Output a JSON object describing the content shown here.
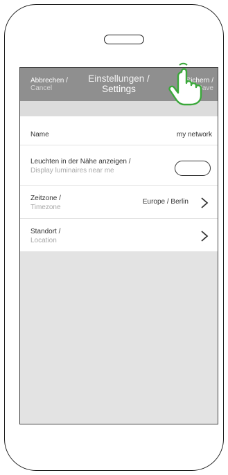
{
  "navbar": {
    "cancel_de": "Abbrechen /",
    "cancel_en": "Cancel",
    "title_de": "Einstellungen /",
    "title_en": "Settings",
    "save_de": "Sichern /",
    "save_en": "Save"
  },
  "settings": {
    "name_label": "Name",
    "name_value": "my network",
    "display_de": "Leuchten in der Nähe anzeigen /",
    "display_en": "Display luminaires near me",
    "timezone_de": "Zeitzone /",
    "timezone_en": "Timezone",
    "timezone_value": "Europe / Berlin",
    "location_de": "Standort /",
    "location_en": "Location"
  },
  "icons": {
    "hand": "tap-hand-icon",
    "chevron": "chevron-right-icon"
  },
  "colors": {
    "navbar": "#8f8f8f",
    "hand_accent": "#3aa83a"
  }
}
